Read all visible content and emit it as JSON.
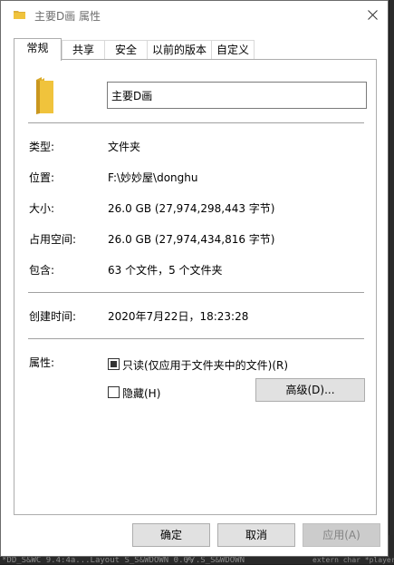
{
  "window": {
    "title": "主要D画 属性",
    "close_glyph": "✕"
  },
  "tabs": [
    {
      "label": "常规",
      "active": true
    },
    {
      "label": "共享",
      "active": false
    },
    {
      "label": "安全",
      "active": false
    },
    {
      "label": "以前的版本",
      "active": false
    },
    {
      "label": "自定义",
      "active": false
    }
  ],
  "general": {
    "folder_name": "主要D画",
    "type_label": "类型:",
    "type_value": "文件夹",
    "location_label": "位置:",
    "location_value": "F:\\妙妙屋\\donghu",
    "size_label": "大小:",
    "size_value": "26.0 GB (27,974,298,443 字节)",
    "disk_size_label": "占用空间:",
    "disk_size_value": "26.0 GB (27,974,434,816 字节)",
    "contains_label": "包含:",
    "contains_value": "63 个文件，5 个文件夹",
    "created_label": "创建时间:",
    "created_value": "2020年7月22日，18:23:28",
    "attributes_label": "属性:",
    "readonly_label": "只读(仅应用于文件夹中的文件)(R)",
    "readonly_state": "indeterminate",
    "hidden_label": "隐藏(H)",
    "hidden_checked": false,
    "advanced_button": "高级(D)..."
  },
  "footer": {
    "ok": "确定",
    "cancel": "取消",
    "apply": "应用(A)"
  },
  "background": {
    "snippet_left": "*DD_S&WC 9.4:4a...Layout S_S&WDOWN 0.0%",
    "snippet_mid": "//.S_S&WDOWN",
    "snippet_right": "extern char *player_m"
  },
  "colors": {
    "folder": "#f0c33c",
    "window_bg": "#ffffff",
    "button_bg": "#e1e1e1",
    "disabled_text": "#838383"
  }
}
